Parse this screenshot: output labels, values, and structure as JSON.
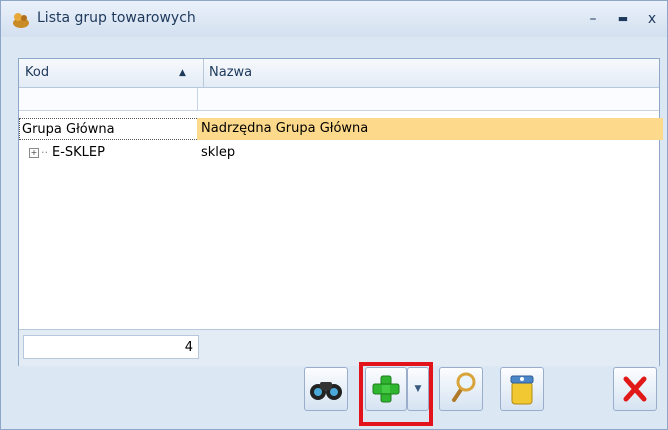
{
  "window": {
    "title": "Lista grup towarowych",
    "minimize_glyph": "–",
    "maximize_glyph": "▬",
    "close_glyph": "x"
  },
  "grid": {
    "columns": [
      {
        "label": "Kod",
        "sort": "ascending",
        "sort_glyph": "▲"
      },
      {
        "label": "Nazwa"
      }
    ],
    "rows": [
      {
        "kod": "Grupa Główna",
        "nazwa": "Nadrzędna Grupa Główna",
        "selected": true
      },
      {
        "kod": "E-SKLEP",
        "nazwa": "sklep",
        "expandable": true,
        "expander_glyph": "+",
        "connector_glyph": "··"
      }
    ],
    "record_count": "4"
  },
  "toolbar": {
    "buttons": [
      {
        "icon": "binoculars-icon"
      },
      {
        "icon": "plus-icon"
      },
      {
        "icon": "chevron-down-icon",
        "glyph": "▼"
      },
      {
        "icon": "magnifier-icon"
      },
      {
        "icon": "trash-icon"
      },
      {
        "icon": "close-icon"
      }
    ]
  },
  "colors": {
    "selected_row": "#fdd98b",
    "highlight": "#e3131c",
    "accent": "#1e395b"
  }
}
